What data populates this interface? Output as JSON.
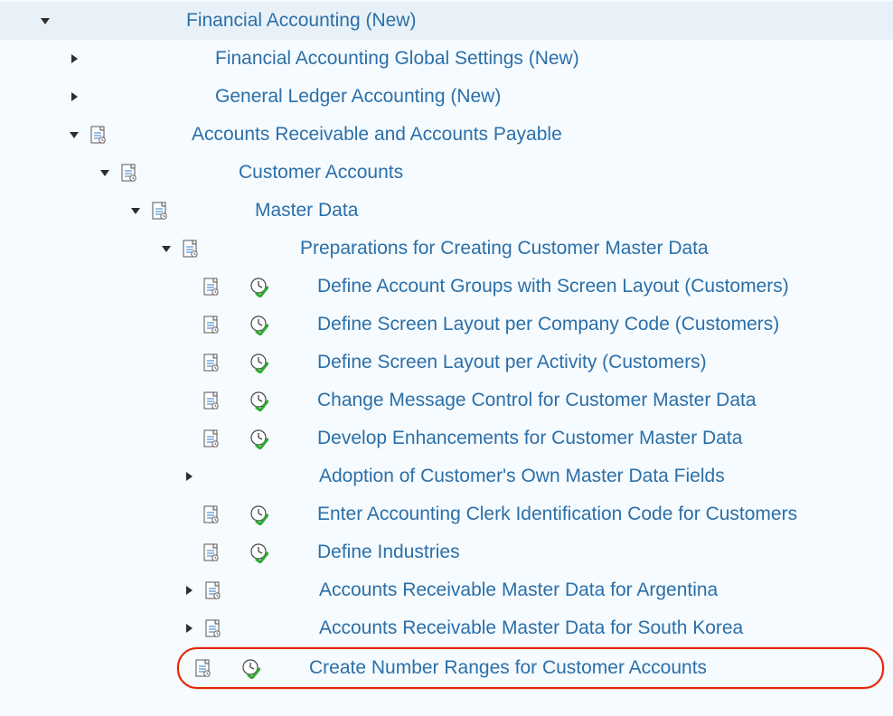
{
  "tree": {
    "root": {
      "label": "Financial Accounting (New)",
      "children": {
        "fags": {
          "label": "Financial Accounting Global Settings (New)"
        },
        "gla": {
          "label": "General Ledger Accounting (New)"
        },
        "arap": {
          "label": "Accounts Receivable and Accounts Payable",
          "children": {
            "cust": {
              "label": "Customer Accounts",
              "children": {
                "md": {
                  "label": "Master Data",
                  "children": {
                    "prep": {
                      "label": "Preparations for Creating Customer Master Data",
                      "items": [
                        "Define Account Groups with Screen Layout (Customers)",
                        "Define Screen Layout per Company Code (Customers)",
                        "Define Screen Layout per Activity (Customers)",
                        "Change Message Control for Customer Master Data",
                        "Develop Enhancements for Customer Master Data",
                        "Adoption of Customer's Own Master Data Fields",
                        "Enter Accounting Clerk Identification Code for Customers",
                        "Define Industries",
                        "Accounts Receivable Master Data for Argentina",
                        "Accounts Receivable Master Data for South Korea",
                        "Create Number Ranges for Customer Accounts"
                      ]
                    }
                  }
                }
              }
            }
          }
        }
      }
    }
  }
}
